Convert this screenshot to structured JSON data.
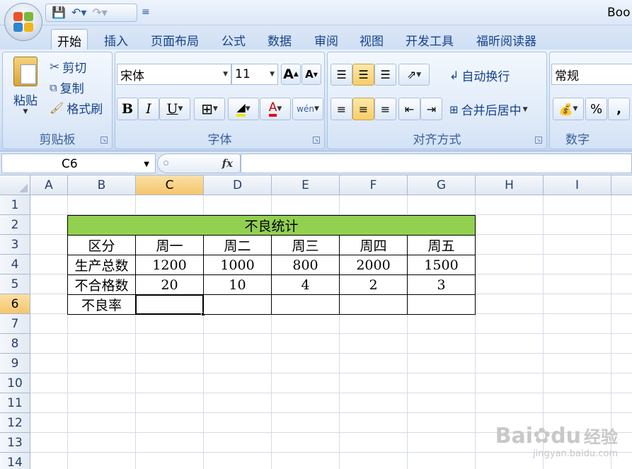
{
  "window": {
    "title": "Boo"
  },
  "ribbon_tabs": [
    "开始",
    "插入",
    "页面布局",
    "公式",
    "数据",
    "审阅",
    "视图",
    "开发工具",
    "福昕阅读器"
  ],
  "clipboard": {
    "paste": "粘贴",
    "cut": "剪切",
    "copy": "复制",
    "format_painter": "格式刷",
    "group": "剪贴板"
  },
  "font": {
    "name": "宋体",
    "size": "11",
    "group": "字体",
    "bold": "B",
    "italic": "I",
    "underline": "U",
    "font_color_glyph": "A",
    "grow_glyph": "A",
    "shrink_glyph": "A",
    "phonetic_glyph": "wén"
  },
  "alignment": {
    "wrap": "自动换行",
    "merge": "合并后居中",
    "group": "对齐方式"
  },
  "number": {
    "format": "常规",
    "percent": "%",
    "comma": ",",
    "group": "数字"
  },
  "formula_bar": {
    "name_box": "C6",
    "fx": "fx"
  },
  "columns": [
    "A",
    "B",
    "C",
    "D",
    "E",
    "F",
    "G",
    "H",
    "I"
  ],
  "rows": [
    "1",
    "2",
    "3",
    "4",
    "5",
    "6",
    "7",
    "8",
    "9",
    "10",
    "11",
    "12",
    "13",
    "14"
  ],
  "selected": {
    "col": "C",
    "row": "6"
  },
  "table": {
    "title": "不良统计",
    "header": [
      "区分",
      "周一",
      "周二",
      "周三",
      "周四",
      "周五"
    ],
    "rows": [
      [
        "生产总数",
        "1200",
        "1000",
        "800",
        "2000",
        "1500"
      ],
      [
        "不合格数",
        "20",
        "10",
        "4",
        "2",
        "3"
      ],
      [
        "不良率",
        "",
        "",
        "",
        "",
        ""
      ]
    ]
  },
  "watermark": {
    "brand": "Bai",
    "brand2": "du",
    "cn": "经验",
    "url": "jingyan.baidu.com"
  },
  "colors": {
    "title_fill": "#92d050",
    "selection": "#f5c66c",
    "ribbon": "#dbe7f7"
  }
}
